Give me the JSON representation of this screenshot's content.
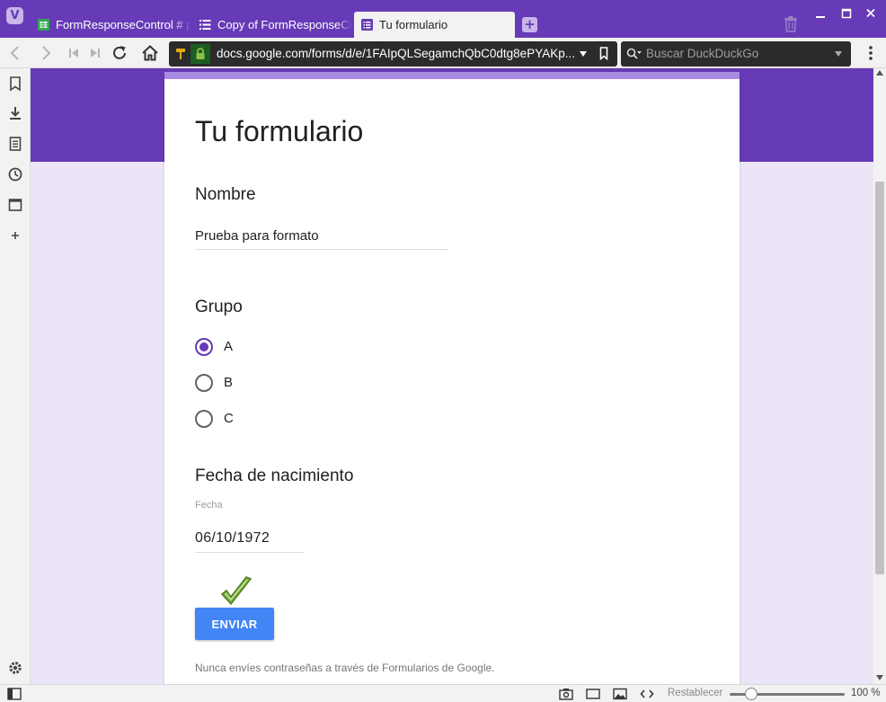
{
  "browser": {
    "tabs": [
      {
        "label": "FormResponseControl # plan"
      },
      {
        "label": "Copy of FormResponseControl"
      },
      {
        "label": "Tu formulario"
      }
    ],
    "url": "docs.google.com/forms/d/e/1FAIpQLSegamchQbC0dtg8ePYAKp...",
    "search_placeholder": "Buscar DuckDuckGo"
  },
  "form": {
    "title": "Tu formulario",
    "questions": {
      "name": {
        "label": "Nombre",
        "value": "Prueba para formato"
      },
      "group": {
        "label": "Grupo",
        "options": [
          "A",
          "B",
          "C"
        ],
        "selected": "A"
      },
      "birthdate": {
        "label": "Fecha de nacimiento",
        "sublabel": "Fecha",
        "value": "06/10/1972"
      }
    },
    "submit_label": "ENVIAR",
    "footer": "Nunca envíes contraseñas a través de Formularios de Google."
  },
  "statusbar": {
    "reset_label": "Restablecer",
    "zoom_label": "100 %",
    "zoom_level": 100
  },
  "colors": {
    "brand": "#673ab7",
    "accent_light": "#a78be0",
    "button": "#4285f4"
  }
}
